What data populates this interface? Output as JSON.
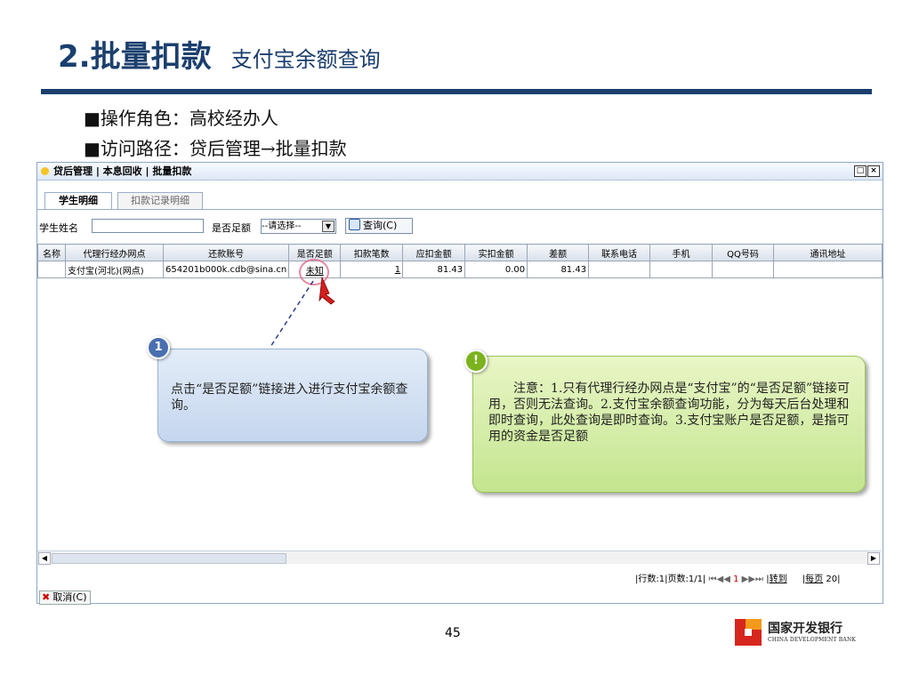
{
  "slide": {
    "title_main": "2.批量扣款",
    "title_sub": "支付宝余额查询",
    "bullet_1": "■操作角色：高校经办人",
    "bullet_2": "■访问路径：贷后管理→批量扣款",
    "page_number": "45",
    "logo_cn": "国家开发银行",
    "logo_en": "CHINA DEVELOPMENT BANK"
  },
  "window": {
    "breadcrumb": "贷后管理 | 本息回收 | 批量扣款",
    "restore_glyph": "□",
    "close_glyph": "×",
    "tabs": [
      {
        "label": "学生明细",
        "active": true
      },
      {
        "label": "扣款记录明细",
        "active": false
      }
    ],
    "filters": {
      "name_label": "学生姓名",
      "name_value": "",
      "sufficient_label": "是否足额",
      "sufficient_value": "--请选择--",
      "query_button": "查询(C)"
    },
    "table": {
      "columns": [
        "名称",
        "代理行经办网点",
        "还款账号",
        "是否足额",
        "扣款笔数",
        "应扣金额",
        "实扣金额",
        "差额",
        "联系电话",
        "手机",
        "QQ号码",
        "通讯地址"
      ],
      "rows": [
        {
          "name": "",
          "agent": "支付宝(河北)(网点)",
          "account": "654201b000k.cdb@sina.cn",
          "sufficient": "未知",
          "count": "1",
          "due": "81.43",
          "paid": "0.00",
          "diff": "81.43",
          "phone": "",
          "mobile": "",
          "qq": "",
          "address": ""
        }
      ]
    },
    "pager": {
      "info": "|行数:1|页数:1/1|",
      "first_prev": "⏮◀◀",
      "current_page": "1",
      "next_last": "▶▶⏭",
      "goto": "转到",
      "per_page_label": "每页",
      "per_page_value": "20"
    },
    "cancel_button": "取消(C)"
  },
  "callouts": {
    "step_badge": "1",
    "step_text": "点击“是否足额”链接进入进行支付宝余额查询。",
    "note_badge": "!",
    "note_text": "注意：1.只有代理行经办网点是“支付宝”的“是否足额”链接可用，否则无法查询。2.支付宝余额查询功能，分为每天后台处理和即时查询，此处查询是即时查询。3.支付宝账户是否足额，是指可用的资金是否足额"
  },
  "colors": {
    "title_blue": "#1b3f6e",
    "note_green": "#c4e58f",
    "step_blue": "#c5d6ee",
    "logo_red": "#d7261e",
    "logo_orange": "#f39a1c"
  }
}
